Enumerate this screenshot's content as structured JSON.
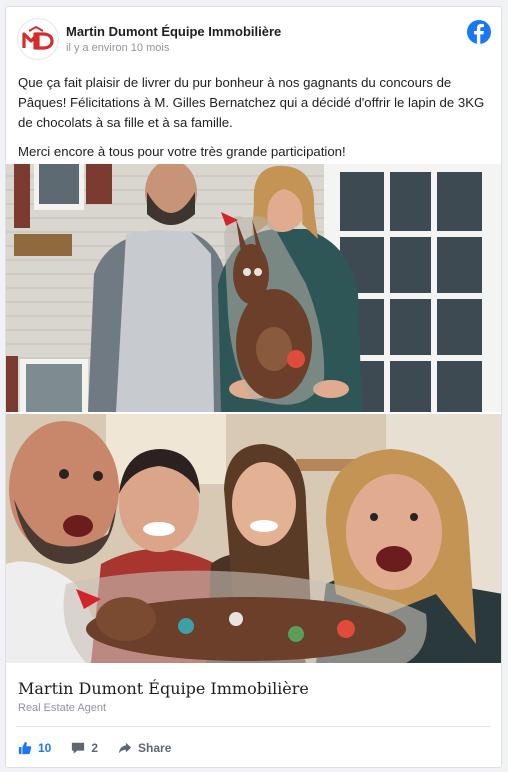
{
  "post": {
    "page_name": "Martin Dumont Équipe Immobilière",
    "time": "il y a environ 10 mois",
    "paragraph1": "Que ça fait plaisir de livrer du pur bonheur à nos gagnants du concours de Pâques! Félicitations à M. Gilles Bernatchez qui a décidé d'offrir le lapin de 3KG de chocolats à sa fille et à sa famille.",
    "paragraph2": "Merci encore à tous pour votre très grande participation!"
  },
  "photos": [
    {
      "name": "photo-couple-chocolate-bunny"
    },
    {
      "name": "photo-family-selfie-chocolate-bunny"
    }
  ],
  "link": {
    "title": "Martin Dumont Équipe Immobilière",
    "subtitle": "Real Estate Agent"
  },
  "actions": {
    "likes": "10",
    "comments": "2",
    "share_label": "Share"
  },
  "colors": {
    "brand_red": "#d62b2b",
    "facebook_blue": "#1877f2"
  },
  "icons": [
    "md-logo-icon",
    "facebook-icon",
    "like-icon",
    "comment-icon",
    "share-icon"
  ]
}
